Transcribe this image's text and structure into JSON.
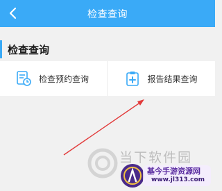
{
  "header": {
    "title": "检查查询",
    "back_icon": "chevron-left-icon"
  },
  "section": {
    "title": "检查查询",
    "accent_color": "#3aaaf7"
  },
  "cards": [
    {
      "label": "检查预约查询",
      "icon": "calendar-list-icon"
    },
    {
      "label": "报告结果查询",
      "icon": "medical-report-icon"
    }
  ],
  "watermark": {
    "brand_text": "当下软件园",
    "site_name": "基今手游资源网",
    "site_url": "www.jl313.com"
  },
  "colors": {
    "header": "#3aaaf7",
    "background": "#f1f1f1",
    "card": "#ffffff",
    "arrow": "#e23b3b"
  }
}
